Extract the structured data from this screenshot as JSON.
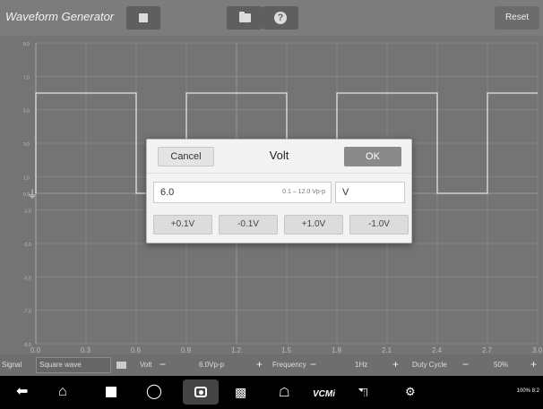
{
  "app": {
    "title": "Waveform Generator"
  },
  "toolbar": {
    "reset_label": "Reset"
  },
  "icons": {
    "stop": "stop-icon",
    "folder": "folder-icon",
    "help": "help-icon",
    "back": "back-icon",
    "home": "home-icon",
    "recents": "recents-icon",
    "browser": "browser-icon",
    "camera": "camera-icon",
    "split": "split-screen-icon",
    "shop": "shop-icon",
    "car": "car-icon",
    "vehicle_tools": "vehicle-tools-icon"
  },
  "graph": {
    "x_ticks": [
      "0.0",
      "0.3",
      "0.6",
      "0.9",
      "1.2",
      "1.5",
      "1.8",
      "2.1",
      "2.4",
      "2.7",
      "3.0"
    ],
    "y_ticks": [
      "9.0",
      "7.0",
      "5.0",
      "3.0",
      "1.0",
      "0.0",
      "-1.0",
      "-3.0",
      "-5.0",
      "-7.0",
      "-9.0"
    ]
  },
  "chart_data": {
    "type": "line",
    "x_range": [
      0,
      3.0
    ],
    "y_range": [
      -9,
      9
    ],
    "series": [
      {
        "x": [
          0,
          0.0,
          0.6,
          0.6,
          0.9,
          0.9,
          1.5,
          1.5,
          1.8,
          1.8,
          2.4,
          2.4,
          2.7,
          2.7,
          3.0
        ],
        "y": [
          0,
          6,
          6,
          0,
          0,
          6,
          6,
          0,
          0,
          6,
          6,
          0,
          0,
          6,
          6
        ]
      }
    ],
    "grid": true
  },
  "dialog": {
    "title": "Volt",
    "cancel_label": "Cancel",
    "ok_label": "OK",
    "value": "6.0",
    "range_hint": "0.1 – 12.0 Vp-p",
    "unit": "V",
    "steps": [
      "+0.1V",
      "-0.1V",
      "+1.0V",
      "-1.0V"
    ]
  },
  "controls": {
    "signal_label": "Signal",
    "signal_value": "Square wave",
    "volt_label": "Volt",
    "volt_value": "6.0Vp-p",
    "frequency_label": "Frequency",
    "frequency_value": "1Hz",
    "duty_label": "Duty Cycle",
    "duty_value": "50%",
    "minus": "−",
    "plus": "+"
  },
  "navbar": {
    "vcmi_label": "VCMi",
    "status_text": "100% 8:2"
  }
}
